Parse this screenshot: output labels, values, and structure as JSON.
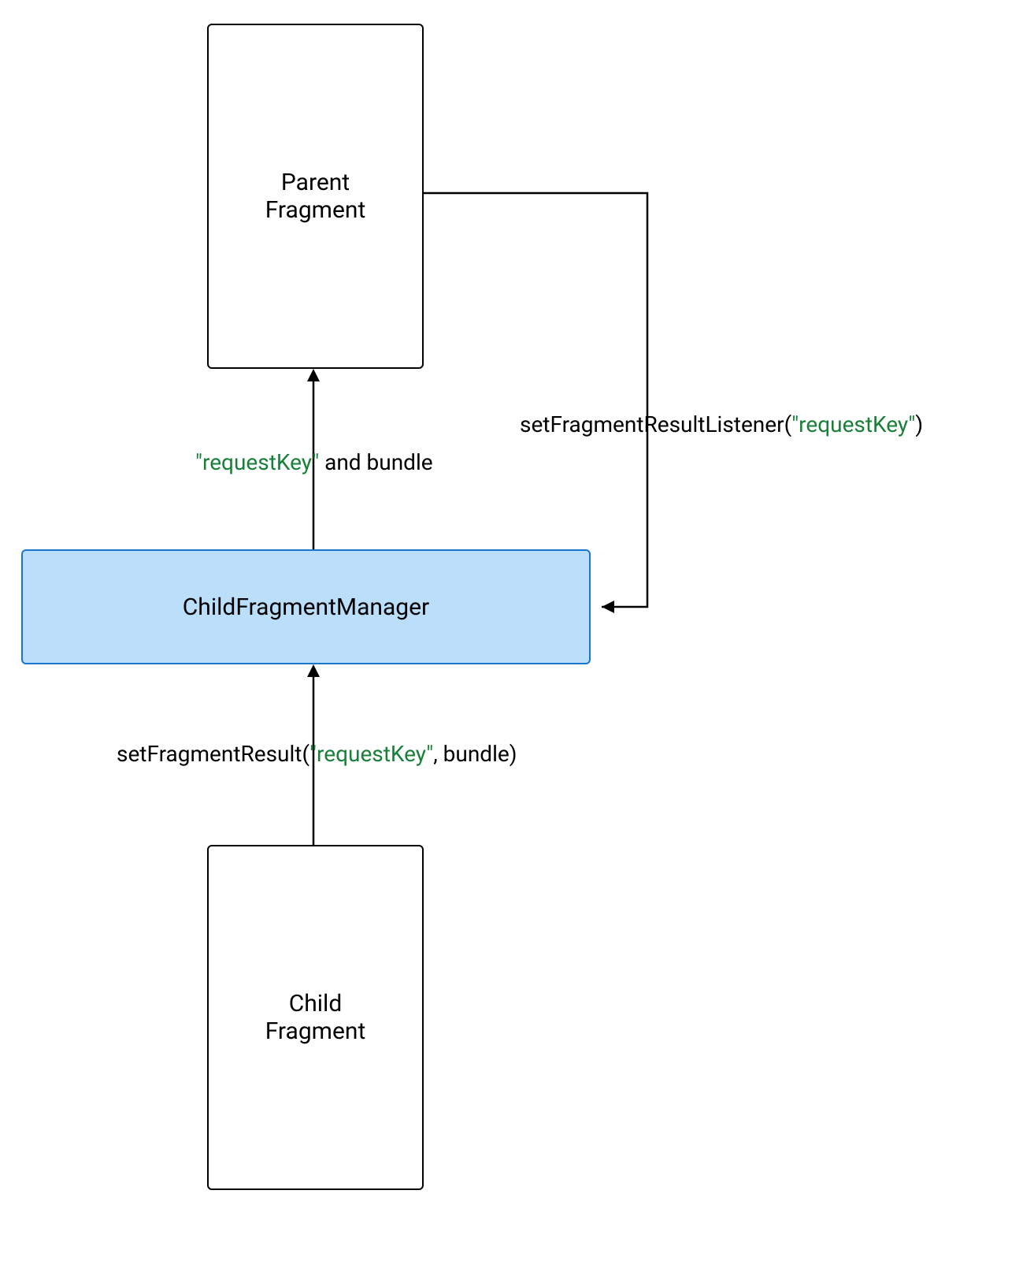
{
  "nodes": {
    "parent": {
      "line1": "Parent",
      "line2": "Fragment"
    },
    "manager": {
      "label": "ChildFragmentManager"
    },
    "child": {
      "line1": "Child",
      "line2": "Fragment"
    }
  },
  "edges": {
    "listener": {
      "prefix": "setFragmentResultListener(",
      "key": "\"requestKey\"",
      "suffix": ")"
    },
    "to_parent": {
      "key": "\"requestKey\"",
      "suffix": " and bundle"
    },
    "set_result": {
      "prefix": "setFragmentResult(",
      "key": "\"requestKey\"",
      "suffix": ", bundle)"
    }
  }
}
